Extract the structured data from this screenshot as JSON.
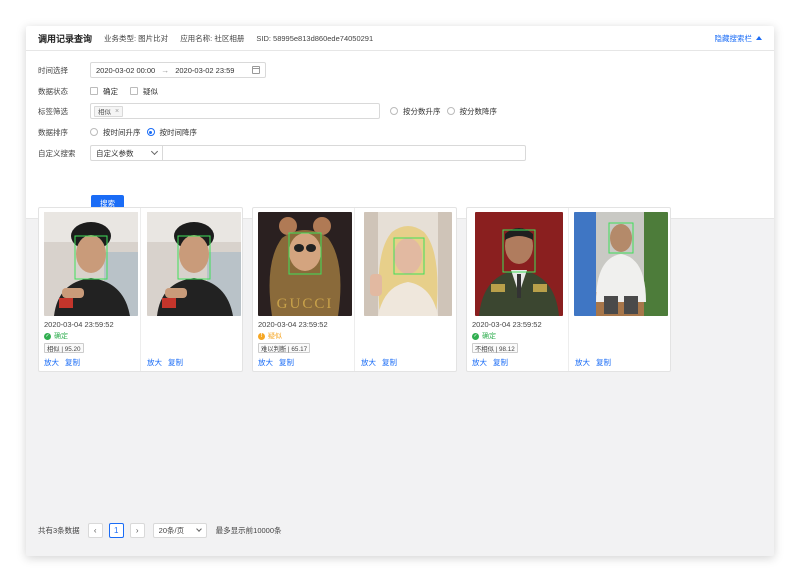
{
  "header": {
    "title": "调用记录查询",
    "business_type": "业务类型: 图片比对",
    "app_name": "应用名称: 社区相册",
    "sid": "SID: 58995e813d860ede74050291",
    "toggle_label": "隐藏搜索栏"
  },
  "filters": {
    "time": {
      "label": "时间选择",
      "start": "2020-03-02 00:00",
      "end": "2020-03-02 23:59"
    },
    "state": {
      "label": "数据状态",
      "options": [
        "确定",
        "疑似"
      ]
    },
    "tags": {
      "label": "标签筛选",
      "selected_tag": "相似",
      "sort_options": [
        "按分数升序",
        "按分数降序"
      ]
    },
    "order": {
      "label": "数据排序",
      "options": [
        "按时间升序",
        "按时间降序"
      ],
      "selected": "按时间降序"
    },
    "custom": {
      "label": "自定义搜索",
      "select_value": "自定义参数",
      "input_value": ""
    },
    "search_button": "搜索"
  },
  "results": [
    {
      "timestamp": "2020-03-04 23:59:52",
      "status": "确定",
      "status_color": "#2fae4f",
      "score": "相似 | 95.20",
      "zoom": "放大",
      "copy": "复制",
      "zoom_b": "放大",
      "copy_b": "复制"
    },
    {
      "timestamp": "2020-03-04 23:59:52",
      "status": "疑似",
      "status_color": "#f5a623",
      "score": "难以判断 | 65.17",
      "zoom": "放大",
      "copy": "复制",
      "zoom_b": "放大",
      "copy_b": "复制"
    },
    {
      "timestamp": "2020-03-04 23:59:52",
      "status": "确定",
      "status_color": "#2fae4f",
      "score": "不相似 | 98.12",
      "zoom": "放大",
      "copy": "复制",
      "zoom_b": "放大",
      "copy_b": "复制"
    }
  ],
  "pagination": {
    "total": "共有3条数据",
    "current_page": "1",
    "page_size": "20条/页",
    "note": "最多显示前10000条"
  },
  "colors": {
    "accent": "#1a6cf6",
    "face_box": "#3fe05a"
  }
}
